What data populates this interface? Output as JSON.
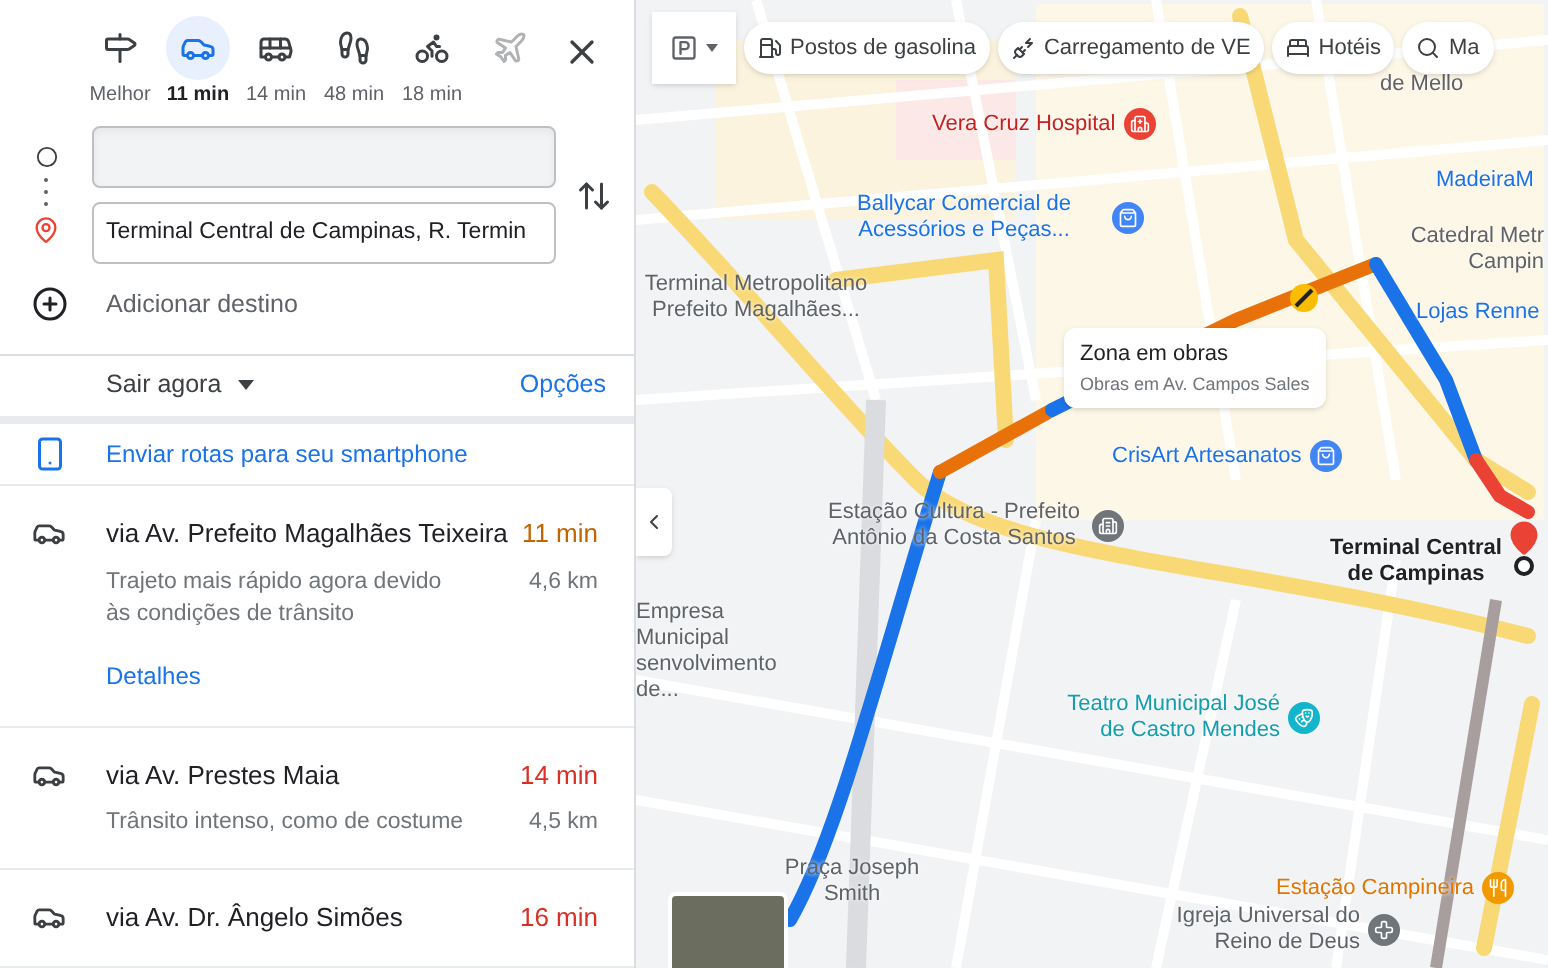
{
  "travel_modes": [
    {
      "kind": "best",
      "label": "Melhor",
      "selected": false,
      "disabled": false
    },
    {
      "kind": "car",
      "label": "11 min",
      "selected": true,
      "disabled": false
    },
    {
      "kind": "transit",
      "label": "14 min",
      "selected": false,
      "disabled": false
    },
    {
      "kind": "walk",
      "label": "48 min",
      "selected": false,
      "disabled": false
    },
    {
      "kind": "bike",
      "label": "18 min",
      "selected": false,
      "disabled": false
    },
    {
      "kind": "flight",
      "selected": false,
      "disabled": true
    }
  ],
  "destination": {
    "value": "Terminal Central de Campinas, R. Termin"
  },
  "add_destination": "Adicionar destino",
  "depart": "Sair agora",
  "options": "Opções",
  "send_to_phone": "Enviar rotas para seu smartphone",
  "routes": [
    {
      "name": "via Av. Prefeito Magalhães Teixeira",
      "time": "11 min",
      "color": "#c26401",
      "description": "Trajeto mais rápido agora devido às condições de trânsito",
      "distance": "4,6 km",
      "details": "Detalhes"
    },
    {
      "name": "via Av. Prestes Maia",
      "time": "14 min",
      "color": "#d93025",
      "description": "Trânsito intenso, como de costume",
      "distance": "4,5 km"
    },
    {
      "name": "via Av. Dr. Ângelo Simões",
      "time": "16 min",
      "color": "#d93025"
    }
  ],
  "map": {
    "chips": [
      "Postos de gasolina",
      "Carregamento de VE",
      "Hotéis",
      "Ma"
    ],
    "places": [
      {
        "kind": "hospital",
        "text": "Vera Cruz Hospital"
      },
      {
        "kind": "shop",
        "text": "Ballycar Comercial de Acessórios e Peças..."
      },
      {
        "kind": "plain",
        "text": "de Mello"
      },
      {
        "kind": "shopname",
        "text": "MadeiraM"
      },
      {
        "kind": "plain",
        "text": "Catedral Metr Campin"
      },
      {
        "kind": "plain",
        "text": "Terminal Metropolitano Prefeito Magalhães..."
      },
      {
        "kind": "shopname",
        "text": "Lojas Renne"
      },
      {
        "kind": "shop",
        "text": "CrisArt Artesanatos"
      },
      {
        "kind": "station",
        "text": "Estação Cultura - Prefeito Antônio da Costa Santos"
      },
      {
        "kind": "terminal",
        "text": "Terminal Central de Campinas"
      },
      {
        "kind": "plain",
        "text": "Empresa Municipal senvolvimento de..."
      },
      {
        "kind": "theatre",
        "text": "Teatro Municipal José de Castro Mendes"
      },
      {
        "kind": "plain",
        "text": "Praça Joseph Smith"
      },
      {
        "kind": "food",
        "text": "Estação Campineira"
      },
      {
        "kind": "church",
        "text": "Igreja Universal do Reino de Deus"
      }
    ],
    "callout": {
      "title": "Zona em obras",
      "subtitle": "Obras em Av. Campos Sales"
    }
  }
}
